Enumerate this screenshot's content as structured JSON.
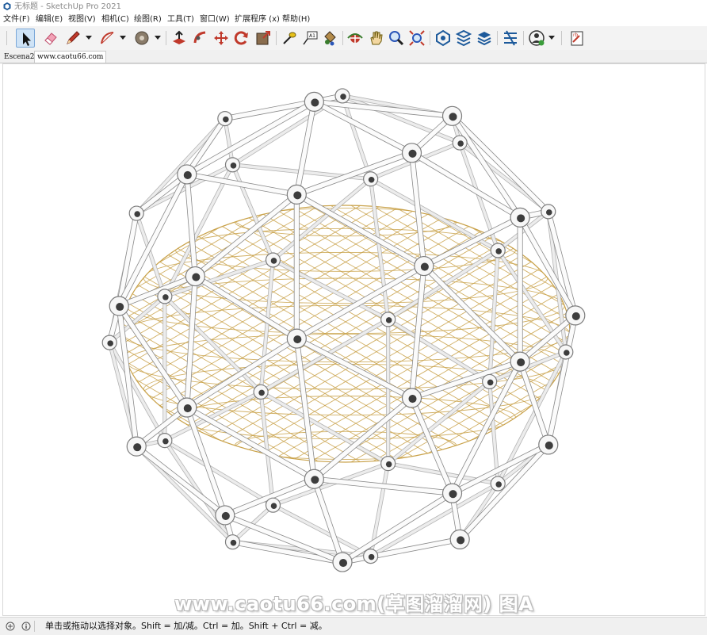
{
  "window": {
    "title": "无标题 - SketchUp Pro 2021"
  },
  "menu": [
    "文件(F)",
    "编辑(E)",
    "视图(V)",
    "相机(C)",
    "绘图(R)",
    "工具(T)",
    "窗口(W)",
    "扩展程序 (x)",
    "帮助(H)"
  ],
  "toolbar": {
    "tools": [
      "select-icon",
      "eraser-icon",
      "pencil-icon",
      "arc-icon",
      "paint-bucket-icon",
      "push-pull-icon",
      "follow-me-icon",
      "move-icon",
      "rotate-icon",
      "scale-icon",
      "tape-measure-icon",
      "text-icon",
      "paint-icon",
      "orbit-icon",
      "pan-icon",
      "zoom-icon",
      "zoom-extents-icon",
      "warehouse-icon",
      "extension-warehouse-icon",
      "layout-icon",
      "extension-manager-icon",
      "account-icon",
      "send-to-layout-icon"
    ]
  },
  "tabs": [
    "Escena2",
    "www.caotu66.com"
  ],
  "watermark": "www.caotu66.com(草图溜溜网) 图A",
  "status": {
    "hint": "单击或拖动以选择对象。Shift = 加/减。Ctrl = 加。Shift + Ctrl = 减。"
  },
  "colors": {
    "accent": "#cfe3f6",
    "frame": "#ffffff",
    "inner_mesh": "#c9a24a"
  }
}
